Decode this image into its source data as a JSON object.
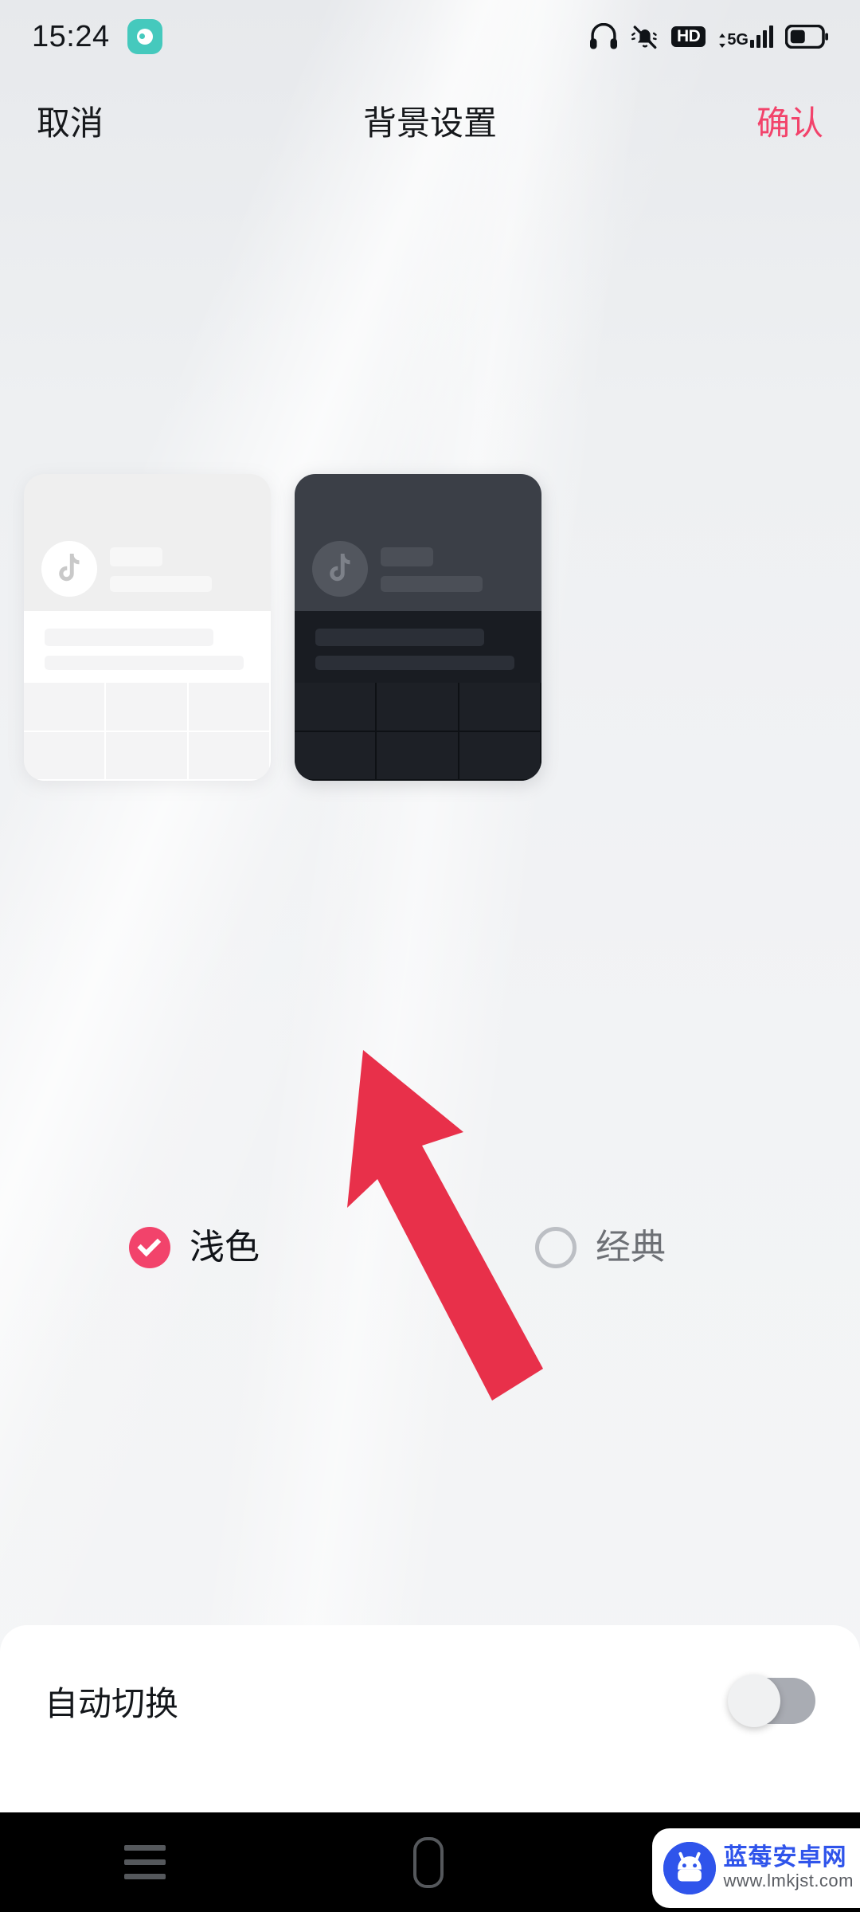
{
  "status_bar": {
    "time": "15:24",
    "app_icon_name": "recorder-app-icon",
    "icons": [
      "headphones-icon",
      "bell-muted-icon",
      "hd-badge-icon",
      "signal-5g-icon",
      "battery-icon"
    ],
    "hd_label": "HD",
    "network_label": "5G"
  },
  "header": {
    "cancel_label": "取消",
    "title": "背景设置",
    "confirm_label": "确认"
  },
  "previews": [
    {
      "name": "light",
      "theme": "light",
      "card_bg": "#efefef",
      "content_bg": "#ffffff",
      "grid_bg": "#f4f4f5",
      "avatar_bg": "#ffffff",
      "logo_name": "tiktok-note-icon"
    },
    {
      "name": "classic",
      "theme": "dark",
      "card_bg": "#3b3f47",
      "content_bg": "#191c22",
      "grid_bg": "#1d2026",
      "avatar_bg": "#52565e",
      "logo_name": "tiktok-note-icon"
    }
  ],
  "options": [
    {
      "label": "浅色",
      "selected": true,
      "accent": "#f2436b"
    },
    {
      "label": "经典",
      "selected": false,
      "accent": "#bcbfc4"
    }
  ],
  "annotation": {
    "shape": "arrow",
    "color": "#e8304a",
    "points_to": "浅色"
  },
  "bottom_panel": {
    "auto_switch_label": "自动切换",
    "auto_switch_on": false
  },
  "nav_bar": {
    "recents_label": "recents-icon",
    "home_label": "home-icon",
    "back_label": "back-icon"
  },
  "watermark": {
    "title": "蓝莓安卓网",
    "url": "www.lmkjst.com",
    "logo_name": "android-robot-icon",
    "color": "#2f54eb"
  }
}
